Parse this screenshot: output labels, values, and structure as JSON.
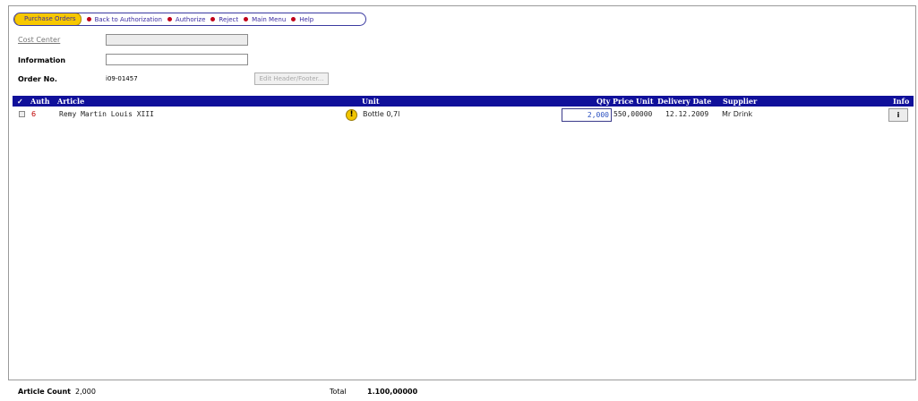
{
  "nav": {
    "active": "Purchase Orders",
    "items": [
      "Back to Authorization",
      "Authorize",
      "Reject",
      "Main Menu",
      "Help"
    ]
  },
  "form": {
    "cost_center_label": "Cost Center",
    "cost_center_value": "",
    "information_label": "Information",
    "information_value": "",
    "order_no_label": "Order No.",
    "order_no_value": "i09-01457",
    "edit_button": "Edit Header/Footer..."
  },
  "table": {
    "headers": {
      "check": "✓",
      "auth": "Auth",
      "article": "Article",
      "unit": "Unit",
      "qty": "Qty",
      "price_unit": "Price Unit",
      "delivery_date": "Delivery Date",
      "supplier": "Supplier",
      "info": "Info"
    },
    "rows": [
      {
        "auth": "6",
        "article": "Remy Martin Louis XIII",
        "warning_icon": "!",
        "unit": "Bottle 0,7l",
        "qty": "2,000",
        "price_unit": "550,00000",
        "delivery_date": "12.12.2009",
        "supplier": "Mr Drink",
        "info": "i"
      }
    ]
  },
  "footer": {
    "article_count_label": "Article Count",
    "article_count_value": "2,000",
    "total_label": "Total",
    "total_value": "1.100,00000"
  },
  "colors": {
    "header_bg": "#10109a",
    "nav_active": "#f7c800",
    "nav_dot": "#c0001a"
  }
}
